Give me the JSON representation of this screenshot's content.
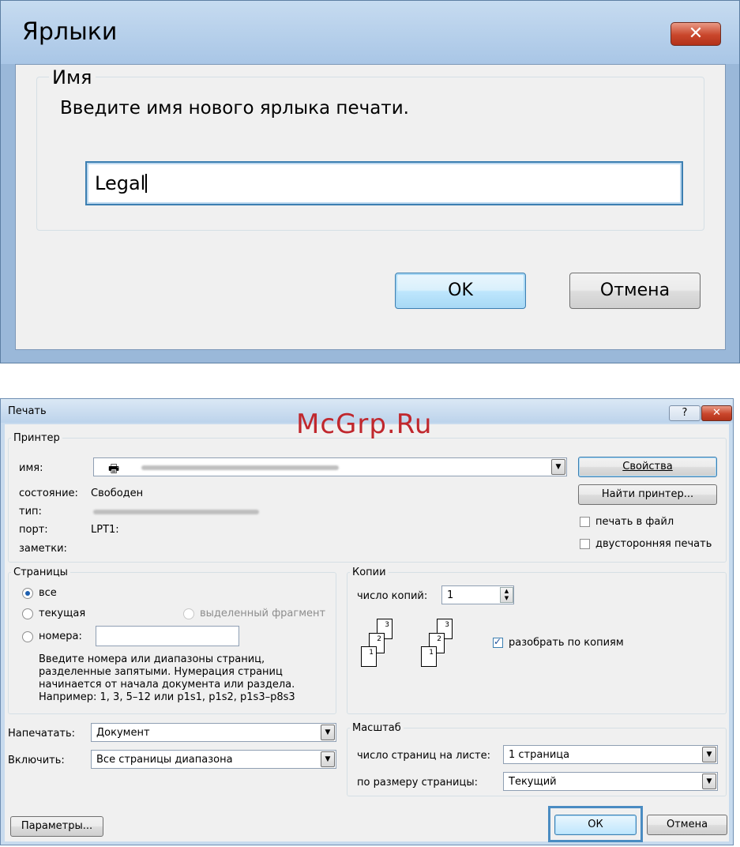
{
  "shortcut_dialog": {
    "title": "Ярлыки",
    "close_icon": "close-icon",
    "group_label": "Имя",
    "prompt": "Введите имя нового ярлыка печати.",
    "name_value": "Legal",
    "ok_label": "OK",
    "cancel_label": "Отмена"
  },
  "watermark": "McGrp.Ru",
  "print_dialog": {
    "title": "Печать",
    "help_label": "?",
    "printer": {
      "group_label": "Принтер",
      "name_label": "имя:",
      "status_label": "состояние:",
      "status_value": "Свободен",
      "type_label": "тип:",
      "port_label": "порт:",
      "port_value": "LPT1:",
      "notes_label": "заметки:",
      "properties_label": "Свойства",
      "find_printer_label": "Найти принтер...",
      "print_to_file_label": "печать в файл",
      "duplex_label": "двусторонняя печать"
    },
    "pages": {
      "group_label": "Страницы",
      "all_label": "все",
      "current_label": "текущая",
      "selection_label": "выделенный фрагмент",
      "pages_label": "номера:",
      "pages_value": "",
      "help_line1": "Введите номера или диапазоны страниц,",
      "help_line2": "разделенные запятыми. Нумерация страниц",
      "help_line3": "начинается от начала документа или раздела.",
      "help_line4": "Например: 1, 3, 5–12 или p1s1, p1s2, p1s3–p8s3"
    },
    "copies": {
      "group_label": "Копии",
      "count_label": "число копий:",
      "count_value": "1",
      "collate_label": "разобрать по копиям",
      "page1": "1",
      "page2": "2",
      "page3": "3"
    },
    "print_what_label": "Напечатать:",
    "print_what_value": "Документ",
    "include_label": "Включить:",
    "include_value": "Все страницы диапазона",
    "scale": {
      "group_label": "Масштаб",
      "pages_per_sheet_label": "число страниц на листе:",
      "pages_per_sheet_value": "1 страница",
      "fit_label": "по размеру страницы:",
      "fit_value": "Текущий"
    },
    "options_label": "Параметры...",
    "ok_label": "ОК",
    "cancel_label": "Отмена"
  }
}
